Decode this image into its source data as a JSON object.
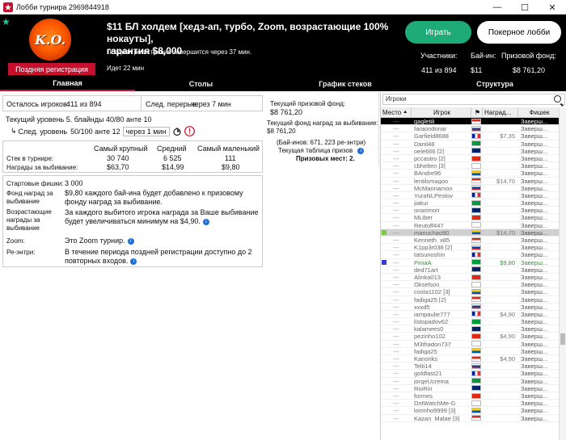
{
  "window": {
    "title": "Лобби турнира 2969844918",
    "minimize": "—",
    "maximize": "☐",
    "close": "✕"
  },
  "header": {
    "badge_text": "K.O.",
    "late_reg_badge": "Поздняя регистрация",
    "title_line1": "$11 БЛ холдем [хедз-ап, турбо, Zoom, возрастающие 100% нокауты],",
    "title_line2": "гарантия $8,000",
    "late_reg_msg": "Поздняя регистрация завершится через 37 мин.",
    "running": "Идет 22 мин",
    "play_button": "Играть",
    "lobby_button": "Покерное лобби",
    "participants_label": "Участники:",
    "participants_value": "411 из 894",
    "buyin_label": "Бай-ин:",
    "buyin_value": "$11",
    "prize_label": "Призовой фонд:",
    "prize_value": "$8 761,20"
  },
  "tabs": [
    "Главная",
    "Столы",
    "График стеков",
    "Структура"
  ],
  "main": {
    "players_left_label": "Осталось игроков:",
    "players_left_value": "411 из 894",
    "next_break_label": "След. перерыв:",
    "next_break_value": "через 7 мин",
    "current_level": "Текущий уровень 5.  блайнды 40/80 анте 10",
    "next_level_label": "След. уровень",
    "next_level_value": "50/100 анте 12",
    "next_level_time": "через 1 мин",
    "col_largest": "Самый крупный",
    "col_average": "Средний",
    "col_smallest": "Самый маленький",
    "row_stack_label": "Стек в турнире:",
    "stack_largest": "30 740",
    "stack_average": "6 525",
    "stack_smallest": "111",
    "row_bounty_label": "Награды за выбивание:",
    "bounty_largest": "$63,70",
    "bounty_average": "$14,99",
    "bounty_smallest": "$9,80",
    "start_chips_label": "Стартовые фишки:",
    "start_chips_value": "3 000",
    "bounty_fund_label": "Фонд наград за выбивание",
    "bounty_fund_value": "$9,80 каждого бай-ина будет добавлено к призовому фонду наград за выбивание.",
    "progressive_label": "Возрастающие награды за выбивание",
    "progressive_value": "За каждого выбитого игрока награда за Ваше выбивание будет увеличиваться минимум на $4,90.",
    "zoom_label": "Zoom:",
    "zoom_value": "Это Zoom турнир.",
    "reentry_label": "Ре-энтри:",
    "reentry_value": "В течение периода поздней регистрации доступно до 2 повторных входов."
  },
  "mid": {
    "current_prize_label": "Текущий призовой фонд:",
    "current_prize_value": "$8 761,20",
    "current_bounty_label": "Текущий фонд наград за выбивание:",
    "current_bounty_value": "$8 761,20",
    "buyins_note": "(Бай-инов: 671, 223 ре-энтри)",
    "prize_table_label": "Текущая таблица призов",
    "prize_places": "Призовых мест: 2."
  },
  "players": {
    "search_placeholder": "Игроки",
    "col_place": "Место",
    "col_player": "Игрок",
    "col_bounty": "Наград...",
    "col_chips": "Фишек",
    "list": [
      {
        "place": "---",
        "name": "gagletili",
        "bounty": "",
        "chips": "Заверш..."
      },
      {
        "place": "---",
        "name": "faraondonar",
        "bounty": "",
        "chips": "Заверш..."
      },
      {
        "place": "---",
        "name": "Garfield8688",
        "bounty": "$7,35",
        "chips": "Заверш..."
      },
      {
        "place": "---",
        "name": "Danil48",
        "bounty": "",
        "chips": "Заверш..."
      },
      {
        "place": "---",
        "name": "oele666 [2]",
        "bounty": "",
        "chips": "Заверш..."
      },
      {
        "place": "---",
        "name": "pccastro [2]",
        "bounty": "",
        "chips": "Заверш..."
      },
      {
        "place": "---",
        "name": "cbhelten [3]",
        "bounty": "",
        "chips": "Заверш..."
      },
      {
        "place": "---",
        "name": "BAndre96",
        "bounty": "",
        "chips": "Заверш..."
      },
      {
        "place": "---",
        "name": "lentilsmagoo",
        "bounty": "$14,70",
        "chips": "Заверш..."
      },
      {
        "place": "---",
        "name": "McMannamon",
        "bounty": "",
        "chips": "Заверш..."
      },
      {
        "place": "---",
        "name": "YuraNLPestov",
        "bounty": "",
        "chips": "Заверш..."
      },
      {
        "place": "---",
        "name": "jiakui",
        "bounty": "",
        "chips": "Заверш..."
      },
      {
        "place": "---",
        "name": "onarimon",
        "bounty": "",
        "chips": "Заверш..."
      },
      {
        "place": "---",
        "name": "MLiber",
        "bounty": "",
        "chips": "Заверш..."
      },
      {
        "place": "---",
        "name": "Reutoff447",
        "bounty": "",
        "chips": "Заверш..."
      },
      {
        "place": "---",
        "name": "manuchao90",
        "bounty": "$14,70",
        "chips": "Заверш..."
      },
      {
        "place": "---",
        "name": "Kenneth_x85",
        "bounty": "",
        "chips": "Заверш..."
      },
      {
        "place": "---",
        "name": "K1pp3r038 [2]",
        "bounty": "",
        "chips": "Заверш..."
      },
      {
        "place": "---",
        "name": "tatsunoshin",
        "bounty": "",
        "chips": "Заверш..."
      },
      {
        "place": "---",
        "name": "PiniaA",
        "bounty": "$9,80",
        "chips": "Заверш..."
      },
      {
        "place": "---",
        "name": "ded71art",
        "bounty": "",
        "chips": "Заверш..."
      },
      {
        "place": "---",
        "name": "Alinka013",
        "bounty": "",
        "chips": "Заверш..."
      },
      {
        "place": "---",
        "name": "Okselson",
        "bounty": "",
        "chips": "Заверш..."
      },
      {
        "place": "---",
        "name": "costa1102 [3]",
        "bounty": "",
        "chips": "Заверш..."
      },
      {
        "place": "---",
        "name": "fadiga25 [2]",
        "bounty": "",
        "chips": "Заверш..."
      },
      {
        "place": "---",
        "name": "xxxd5",
        "bounty": "",
        "chips": "Заверш..."
      },
      {
        "place": "---",
        "name": "iampaulie777",
        "bounty": "$4,90",
        "chips": "Заверш..."
      },
      {
        "place": "---",
        "name": "listopadov62",
        "bounty": "",
        "chips": "Заверш..."
      },
      {
        "place": "---",
        "name": "kalamees0",
        "bounty": "",
        "chips": "Заверш..."
      },
      {
        "place": "---",
        "name": "pezinho102",
        "bounty": "$4,90",
        "chips": "Заверш..."
      },
      {
        "place": "---",
        "name": "M3thadon737",
        "bounty": "",
        "chips": "Заверш..."
      },
      {
        "place": "---",
        "name": "fadiga25",
        "bounty": "",
        "chips": "Заверш..."
      },
      {
        "place": "---",
        "name": "Kanoriks",
        "bounty": "$4,90",
        "chips": "Заверш..."
      },
      {
        "place": "---",
        "name": "Telti14",
        "bounty": "",
        "chips": "Заверш..."
      },
      {
        "place": "---",
        "name": "goldfast21",
        "bounty": "",
        "chips": "Заверш..."
      },
      {
        "place": "---",
        "name": "jorgeUcrema",
        "bounty": "",
        "chips": "Заверш..."
      },
      {
        "place": "---",
        "name": "RioRin",
        "bounty": "",
        "chips": "Заверш..."
      },
      {
        "place": "---",
        "name": "formes",
        "bounty": "",
        "chips": "Заверш..."
      },
      {
        "place": "---",
        "name": "DntWatchMe-G",
        "bounty": "",
        "chips": "Заверш..."
      },
      {
        "place": "---",
        "name": "loirinho9999 [3]",
        "bounty": "",
        "chips": "Заверш..."
      },
      {
        "place": "---",
        "name": "Kazan_Malae [3]",
        "bounty": "",
        "chips": "Заверш..."
      }
    ]
  }
}
